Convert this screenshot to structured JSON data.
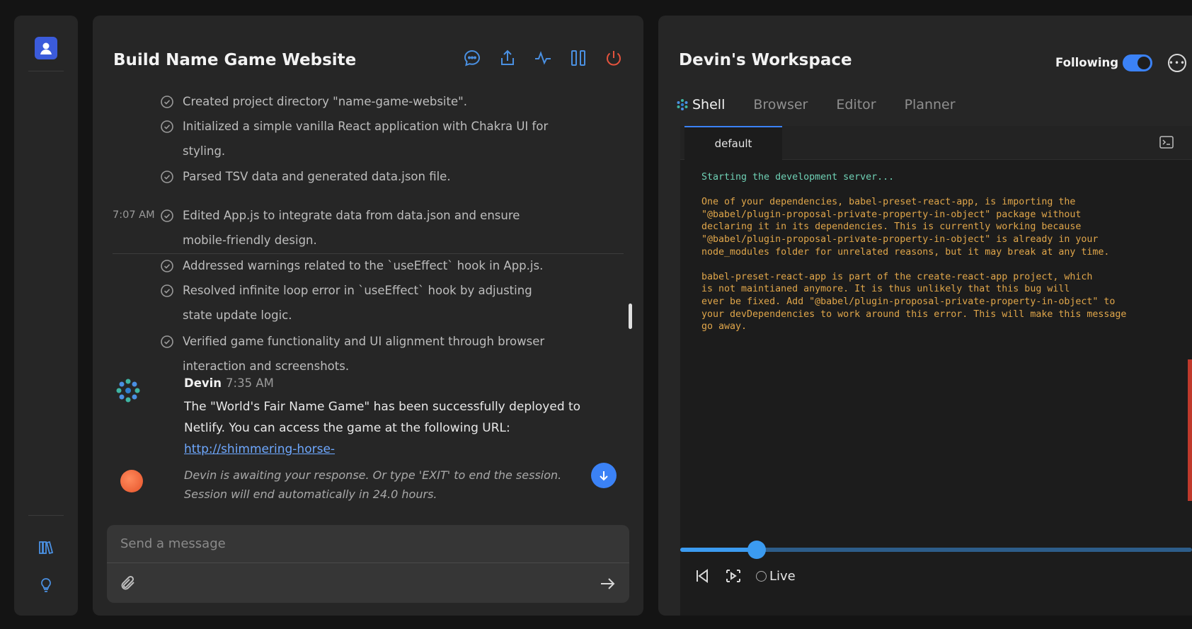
{
  "chat": {
    "title": "Build Name Game Website",
    "tools": [
      "chat-icon",
      "share-icon",
      "activity-icon",
      "columns-icon",
      "power-icon"
    ],
    "steps": [
      {
        "text": "Created project directory \"name-game-website\"."
      },
      {
        "text": "Initialized a simple vanilla React application with Chakra UI for styling."
      },
      {
        "text": "Parsed TSV data and generated data.json file."
      },
      {
        "text": "Edited App.js to integrate data from data.json and ensure mobile-friendly design.",
        "time": "7:07 AM"
      },
      {
        "text": "Addressed warnings related to the `useEffect` hook in App.js."
      },
      {
        "text": "Resolved infinite loop error in `useEffect` hook by adjusting state update logic."
      },
      {
        "text": "Verified game functionality and UI alignment through browser interaction and screenshots."
      }
    ],
    "message": {
      "author": "Devin",
      "time": "7:35 AM",
      "body": "The \"World's Fair Name Game\" has been successfully deployed to Netlify. You can access the game at the following URL: ",
      "link": "http://shimmering-horse-"
    },
    "awaiting": "Devin is awaiting your response. Or type 'EXIT' to end the session. Session will end automatically in 24.0 hours.",
    "composer": {
      "placeholder": "Send a message"
    }
  },
  "workspace": {
    "title": "Devin's Workspace",
    "following_label": "Following",
    "following": true,
    "tabs": [
      "Shell",
      "Browser",
      "Editor",
      "Planner"
    ],
    "active_tab": "Shell",
    "terminal": {
      "tab_label": "default",
      "output_first": "Starting the development server...",
      "output_rest": "One of your dependencies, babel-preset-react-app, is importing the\n\"@babel/plugin-proposal-private-property-in-object\" package without\ndeclaring it in its dependencies. This is currently working because\n\"@babel/plugin-proposal-private-property-in-object\" is already in your\nnode_modules folder for unrelated reasons, but it may break at any time.\n\nbabel-preset-react-app is part of the create-react-app project, which\nis not maintianed anymore. It is thus unlikely that this bug will\never be fixed. Add \"@babel/plugin-proposal-private-property-in-object\" to\nyour devDependencies to work around this error. This will make this message\ngo away."
    },
    "playback": {
      "progress": 0.15,
      "live_label": "Live"
    }
  },
  "colors": {
    "accent": "#3b82f6",
    "power": "#e5533d",
    "terminal_text": "#e0a64a",
    "terminal_info": "#6fd1b5"
  }
}
